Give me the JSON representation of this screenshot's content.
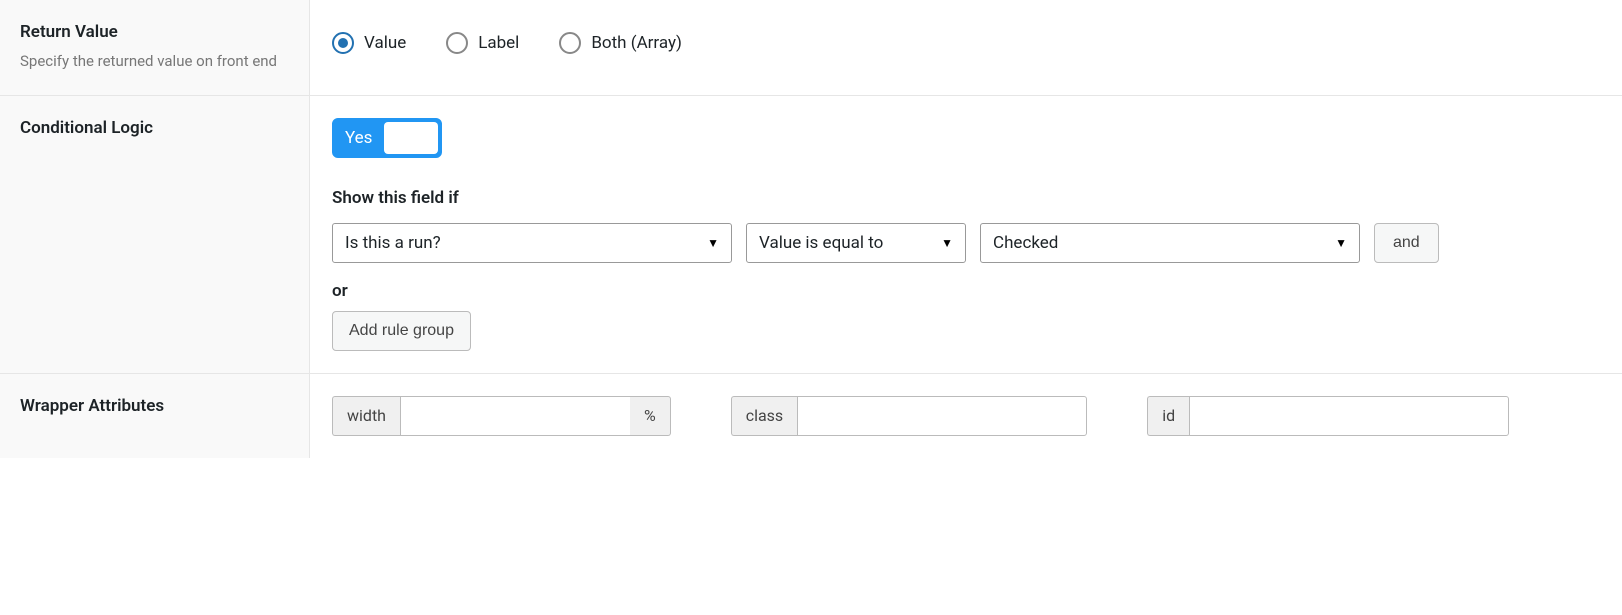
{
  "return_value": {
    "label": "Return Value",
    "description": "Specify the returned value on front end",
    "options": {
      "value": "Value",
      "label": "Label",
      "both": "Both (Array)"
    }
  },
  "conditional_logic": {
    "label": "Conditional Logic",
    "toggle": "Yes",
    "rules_title": "Show this field if",
    "rule": {
      "field": "Is this a run?",
      "operator": "Value is equal to",
      "value": "Checked"
    },
    "and_btn": "and",
    "or_text": "or",
    "add_group_btn": "Add rule group"
  },
  "wrapper": {
    "label": "Wrapper Attributes",
    "width_label": "width",
    "width_suffix": "%",
    "class_label": "class",
    "id_label": "id"
  }
}
